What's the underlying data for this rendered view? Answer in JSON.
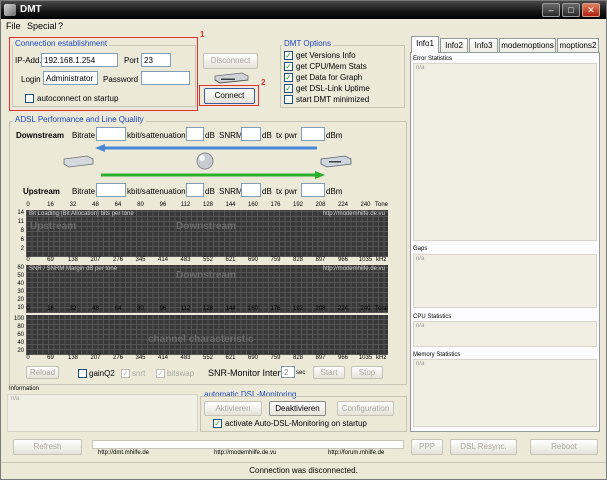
{
  "window": {
    "title": "DMT"
  },
  "menu": [
    "File",
    "Special",
    "?"
  ],
  "annotations": {
    "box1": "1",
    "box2": "2"
  },
  "connection": {
    "title": "Connection establishment",
    "ip_label": "IP-Add.",
    "ip_value": "192.168.1.254",
    "port_label": "Port",
    "port_value": "23",
    "login_label": "Login",
    "login_value": "Administrator",
    "password_label": "Password",
    "password_value": "",
    "autoconnect_label": "autoconnect on startup"
  },
  "actions": {
    "disconnect": "Disconnect",
    "connect": "Connect"
  },
  "dmt_options": {
    "title": "DMT Options",
    "items": [
      {
        "label": "get Versions Info",
        "checked": true
      },
      {
        "label": "get CPU/Mem Stats",
        "checked": true
      },
      {
        "label": "get Data for Graph",
        "checked": true
      },
      {
        "label": "get DSL-Link Uptime",
        "checked": true
      },
      {
        "label": "start DMT minimized",
        "checked": false
      }
    ]
  },
  "adsl": {
    "title": "ADSL Performance and Line Quality",
    "downstream": "Downstream",
    "upstream": "Upstream",
    "bitrate": "Bitrate",
    "kbits": "kbit/s",
    "attenuation": "attenuation",
    "db": "dB",
    "snrm": "SNRM",
    "txpwr": "tx pwr",
    "dbm": "dBm"
  },
  "axes": {
    "ticks_a": [
      "0",
      "16",
      "32",
      "48",
      "64",
      "80",
      "96",
      "112",
      "128",
      "144",
      "160",
      "176",
      "192",
      "208",
      "224",
      "240"
    ],
    "ticks_b": [
      "0",
      "69",
      "138",
      "207",
      "276",
      "345",
      "414",
      "483",
      "552",
      "621",
      "690",
      "759",
      "828",
      "897",
      "966",
      "1035"
    ],
    "unit_tone": "Tone",
    "unit_khz": "kHz",
    "y_bits": [
      "14",
      "11",
      "8",
      "6",
      "2"
    ],
    "y_snr": [
      "60",
      "50",
      "40",
      "30",
      "20",
      "10"
    ],
    "y_char": [
      "100",
      "80",
      "60",
      "40",
      "20"
    ]
  },
  "plots": {
    "bits_caption": "Bit Loading (Bit Allocation) bits per tone",
    "snr_caption": "SNR / SNRM Margin dB per tone",
    "url": "http://modemhilfe.de.vu",
    "wm_upstream": "Upstream",
    "wm_downstream": "Downstream",
    "wm_channel": "channel characteristic"
  },
  "bottom_controls": {
    "reload": "Reload",
    "gainq2": "gainQ2",
    "snrt": "snrt",
    "bitswap": "bitswap",
    "snr_interval": "SNR-Monitor Interval:",
    "interval_value": "2",
    "sec": "sec",
    "start": "Start",
    "stop": "Stop"
  },
  "information": {
    "title": "Information",
    "text": "n/a"
  },
  "auto_dsl": {
    "title": "automatic DSL-Monitoring",
    "activate": "Aktivieren",
    "deactivate": "Deaktivieren",
    "configuration": "Configuration",
    "startup_label": "activate Auto-DSL-Monitoring on startup"
  },
  "right_tabs": [
    "Info1",
    "Info2",
    "Info3",
    "modemoptions",
    "moptions2"
  ],
  "right_sections": {
    "error_title": "Error Statistics",
    "error_value": "n/a",
    "gaps_title": "Gaps",
    "gaps_value": "n/a",
    "cpu_title": "CPU Statistics",
    "cpu_value": "n/a",
    "mem_title": "Memory Statistics",
    "mem_value": "n/a"
  },
  "footer": {
    "refresh": "Refresh",
    "ppp": "PPP",
    "dsl_resync": "DSL Resync.",
    "reboot": "Reboot",
    "url1": "http://dmt.mhilfe.de",
    "url2": "http://modemhilfe.de.vu",
    "url3": "http://forum.mhilfe.de",
    "status": "Connection was disconnected."
  },
  "colors": {
    "arrow_down": "#4a86d8",
    "arrow_up": "#2ab02a",
    "group_title": "#1b49c0",
    "annotation_red": "#e03030"
  }
}
